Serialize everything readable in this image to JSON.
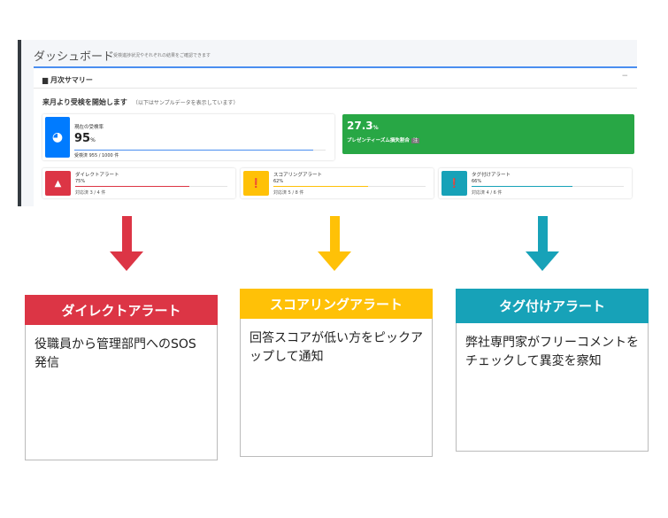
{
  "dashboard": {
    "title": "ダッシュボード",
    "subtitle": "受検進捗状況やそれぞれの結果をご確認できます",
    "card_title": "月次サマリー",
    "collapse": "−",
    "lead": "来月より受検を開始します",
    "lead_note": "（以下はサンプルデータを表示しています）",
    "rate": {
      "label": "現在の受検率",
      "value": "95",
      "unit": "%",
      "detail": "受検済 955 / 1000 件",
      "progress": 95
    },
    "presenteeism": {
      "value": "27.3",
      "unit": "%",
      "label": "プレゼンティーズム損失割合",
      "badge": "注"
    },
    "alerts": [
      {
        "label": "ダイレクトアラート",
        "pct": "75%",
        "detail": "対応済 3 / 4 件",
        "progress": 75,
        "color": "#dc3545",
        "icon": "warning-icon"
      },
      {
        "label": "スコアリングアラート",
        "pct": "62%",
        "detail": "対応済 5 / 8 件",
        "progress": 62,
        "color": "#ffc107",
        "icon": "exclamation-icon"
      },
      {
        "label": "タグ付けアラート",
        "pct": "66%",
        "detail": "対応済 4 / 6 件",
        "progress": 66,
        "color": "#17a2b8",
        "icon": "exclamation-icon"
      }
    ]
  },
  "panels": [
    {
      "title": "ダイレクトアラート",
      "body": "役職員から管理部門へのSOS発信",
      "color": "#dc3545"
    },
    {
      "title": "スコアリングアラート",
      "body": "回答スコアが低い方をピックアップして通知",
      "color": "#ffc107"
    },
    {
      "title": "タグ付けアラート",
      "body": "弊社専門家がフリーコメントをチェックして異変を察知",
      "color": "#17a2b8"
    }
  ]
}
